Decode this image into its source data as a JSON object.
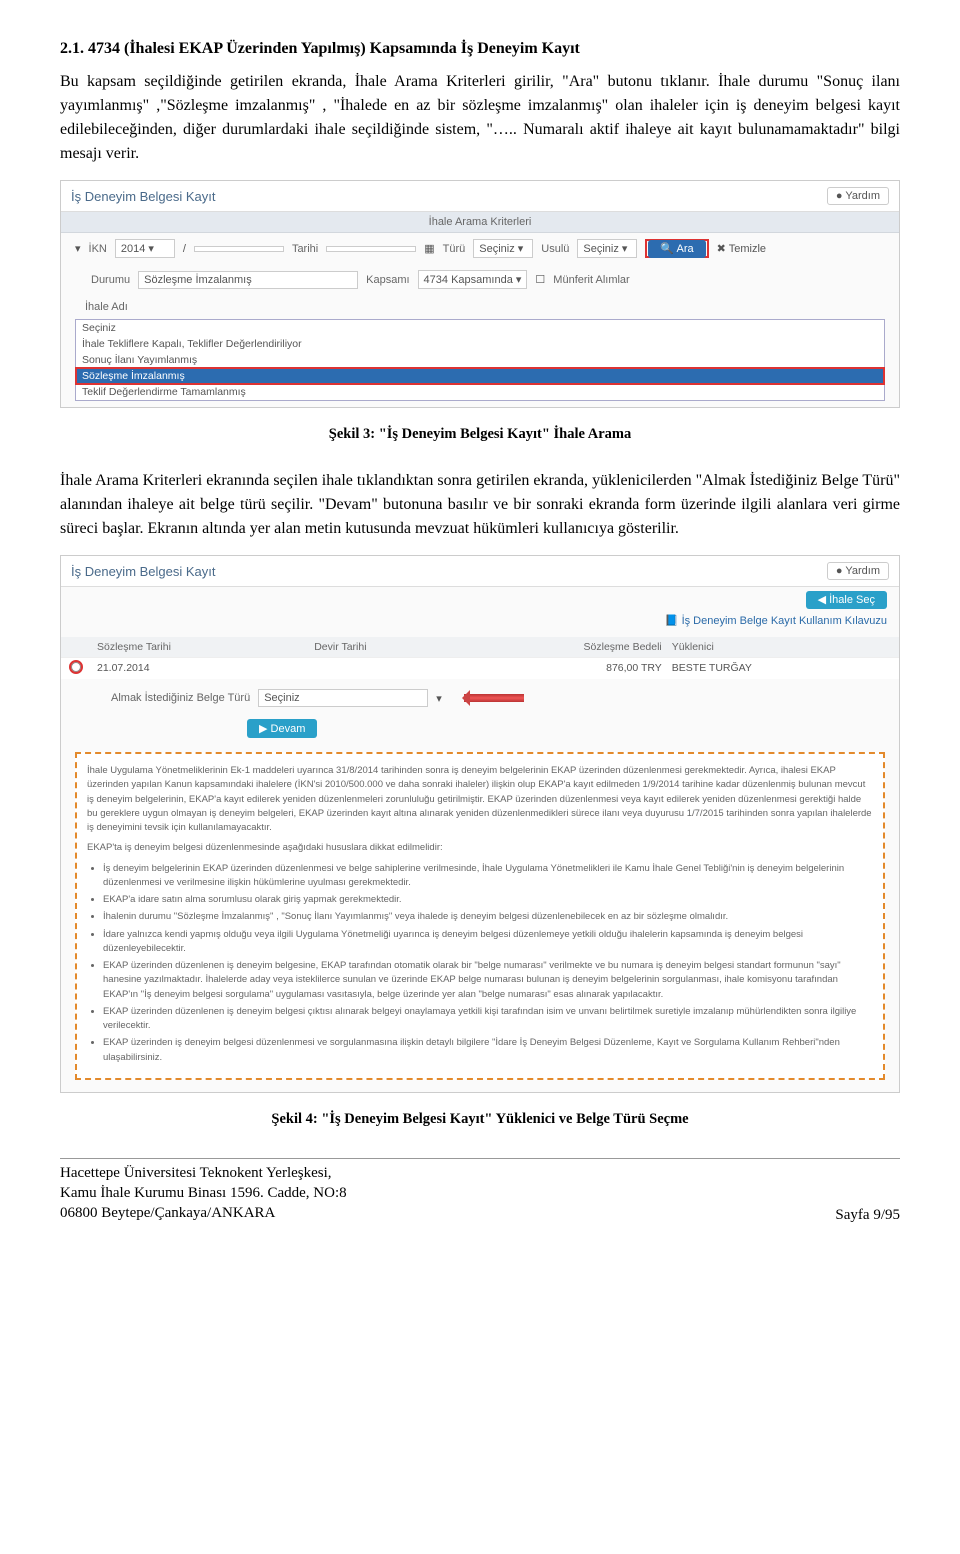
{
  "heading": "2.1. 4734 (İhalesi EKAP Üzerinden Yapılmış) Kapsamında İş Deneyim Kayıt",
  "para1": "Bu kapsam seçildiğinde getirilen ekranda, İhale Arama Kriterleri girilir, \"Ara\" butonu tıklanır. İhale durumu \"Sonuç ilanı yayımlanmış\" ,\"Sözleşme imzalanmış\" , \"İhalede en az bir sözleşme imzalanmış\" olan ihaleler için iş deneyim belgesi kayıt edilebileceğinden, diğer durumlardaki ihale seçildiğinde sistem, \"….. Numaralı aktif ihaleye ait kayıt bulunamamaktadır\" bilgi mesajı verir.",
  "fig1_title": "İş Deneyim Belgesi Kayıt",
  "help": "Yardım",
  "band": "İhale Arama Kriterleri",
  "ikn": "İKN",
  "year": "2014",
  "slash": "/",
  "tarihi": "Tarihi",
  "turu": "Türü",
  "seciniz": "Seçiniz",
  "usulu": "Usulü",
  "ara": "Ara",
  "temizle": "Temizle",
  "durumu": "Durumu",
  "durumu_val": "Sözleşme İmzalanmış",
  "kapsami": "Kapsamı",
  "kapsami_val": "4734 Kapsamında",
  "munferit": "Münferit Alımlar",
  "ihaleadi": "İhale Adı",
  "dd1": "Seçiniz",
  "dd2": "İhale Tekliflere Kapalı, Teklifler Değerlendiriliyor",
  "dd3": "Sonuç İlanı Yayımlanmış",
  "dd4": "Sözleşme İmzalanmış",
  "dd5": "Teklif Değerlendirme Tamamlanmış",
  "caption1": "Şekil 3: \"İş Deneyim Belgesi Kayıt\" İhale Arama",
  "para2": "İhale Arama Kriterleri ekranında seçilen ihale tıklandıktan sonra getirilen ekranda, yüklenicilerden \"Almak İstediğiniz Belge Türü\" alanından ihaleye ait belge türü seçilir. \"Devam\" butonuna basılır ve bir sonraki ekranda form üzerinde ilgili alanlara veri girme süreci başlar. Ekranın altında yer alan metin kutusunda mevzuat hükümleri kullanıcıya gösterilir.",
  "ihale_sec": "İhale Seç",
  "kilavuz": "İş Deneyim Belge Kayıt Kullanım Kılavuzu",
  "th1": "Sözleşme Tarihi",
  "th2": "Devir Tarihi",
  "th3": "Sözleşme Bedeli",
  "th4": "Yüklenici",
  "td1": "21.07.2014",
  "td3": "876,00 TRY",
  "td4": "BESTE TURĞAY",
  "almak": "Almak İstediğiniz Belge Türü",
  "devam": "Devam",
  "notice_p1": "İhale Uygulama Yönetmeliklerinin Ek-1 maddeleri uyarınca 31/8/2014 tarihinden sonra iş deneyim belgelerinin EKAP üzerinden düzenlenmesi gerekmektedir. Ayrıca, ihalesi EKAP üzerinden yapılan Kanun kapsamındaki ihalelere (İKN'si 2010/500.000 ve daha sonraki ihaleler) ilişkin olup EKAP'a kayıt edilmeden 1/9/2014 tarihine kadar düzenlenmiş bulunan mevcut iş deneyim belgelerinin, EKAP'a kayıt edilerek yeniden düzenlenmeleri zorunluluğu getirilmiştir. EKAP üzerinden düzenlenmesi veya kayıt edilerek yeniden düzenlenmesi gerektiği halde bu gereklere uygun olmayan iş deneyim belgeleri, EKAP üzerinden kayıt altına alınarak yeniden düzenlenmedikleri sürece ilanı veya duyurusu 1/7/2015 tarihinden sonra yapılan ihalelerde iş deneyimini tevsik için kullanılamayacaktır.",
  "notice_p2": "EKAP'ta iş deneyim belgesi düzenlenmesinde aşağıdaki hususlara dikkat edilmelidir:",
  "b1": "İş deneyim belgelerinin EKAP üzerinden düzenlenmesi ve belge sahiplerine verilmesinde, İhale Uygulama Yönetmelikleri ile Kamu İhale Genel Tebliği'nin iş deneyim belgelerinin düzenlenmesi ve verilmesine ilişkin hükümlerine uyulması gerekmektedir.",
  "b2": "EKAP'a idare satın alma sorumlusu olarak giriş yapmak gerekmektedir.",
  "b3": "İhalenin durumu \"Sözleşme İmzalanmış\" , \"Sonuç İlanı Yayımlanmış\" veya ihalede iş deneyim belgesi düzenlenebilecek en az bir sözleşme olmalıdır.",
  "b4": "İdare yalnızca kendi yapmış olduğu veya ilgili Uygulama Yönetmeliği uyarınca iş deneyim belgesi düzenlemeye yetkili olduğu ihalelerin kapsamında iş deneyim belgesi düzenleyebilecektir.",
  "b5": "EKAP üzerinden düzenlenen iş deneyim belgesine, EKAP tarafından otomatik olarak bir \"belge numarası\" verilmekte ve bu numara iş deneyim belgesi standart formunun \"sayı\" hanesine yazılmaktadır. İhalelerde aday veya isteklilerce sunulan ve üzerinde EKAP belge numarası bulunan iş deneyim belgelerinin sorgulanması, ihale komisyonu tarafından EKAP'ın \"İş deneyim belgesi sorgulama\" uygulaması vasıtasıyla, belge üzerinde yer alan \"belge numarası\" esas alınarak yapılacaktır.",
  "b6": "EKAP üzerinden düzenlenen iş deneyim belgesi çıktısı alınarak belgeyi onaylamaya yetkili kişi tarafından isim ve unvanı belirtilmek suretiyle imzalanıp mühürlendikten sonra ilgiliye verilecektir.",
  "b7": "EKAP üzerinden iş deneyim belgesi düzenlenmesi ve sorgulanmasına ilişkin detaylı bilgilere \"İdare İş Deneyim Belgesi Düzenleme, Kayıt ve Sorgulama Kullanım Rehberi\"nden ulaşabilirsiniz.",
  "caption2": "Şekil 4: \"İş Deneyim Belgesi Kayıt\" Yüklenici ve Belge Türü Seçme",
  "footer1": "Hacettepe Üniversitesi Teknokent Yerleşkesi,",
  "footer2": "Kamu İhale Kurumu Binası 1596. Cadde, NO:8",
  "footer3": "06800 Beytepe/Çankaya/ANKARA",
  "page": "Sayfa 9/95"
}
